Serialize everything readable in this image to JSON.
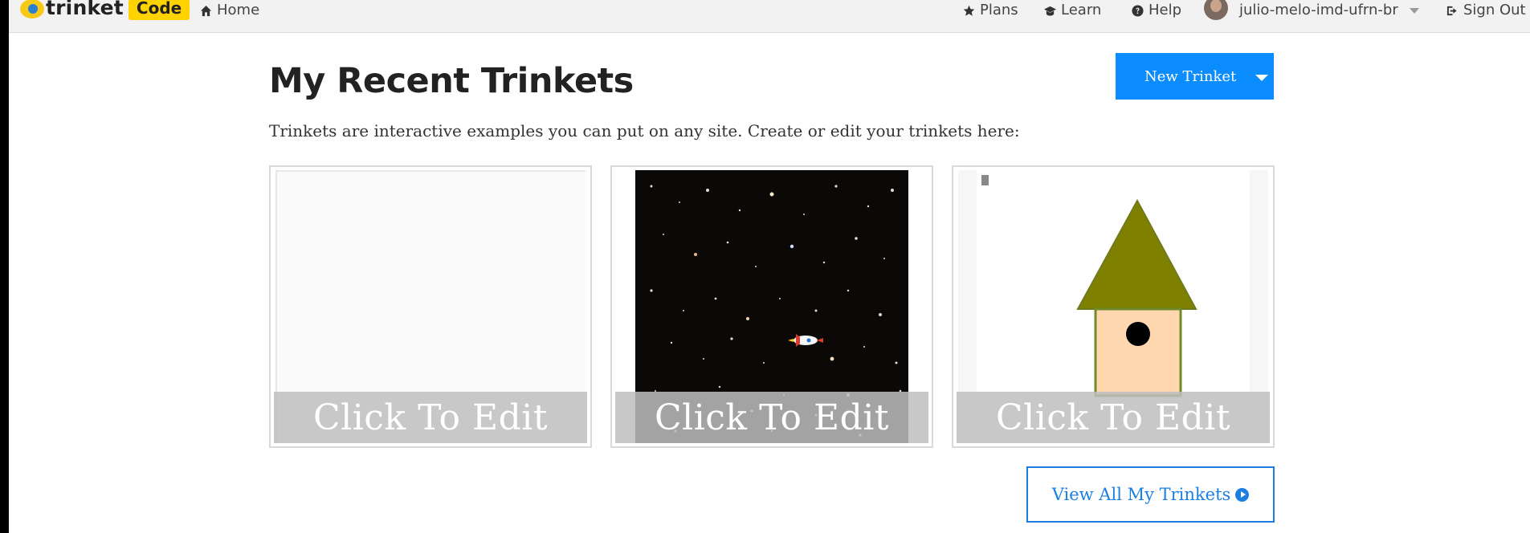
{
  "header": {
    "logo_text": "trinket",
    "logo_badge": "Code",
    "nav": {
      "home": "Home",
      "plans": "Plans",
      "learn": "Learn",
      "help": "Help",
      "username": "julio-melo-imd-ufrn-br",
      "signout": "Sign Out"
    },
    "icons": {
      "home": "home-icon",
      "plans": "star-icon",
      "learn": "graduation-cap-icon",
      "help": "question-circle-icon",
      "signout": "sign-out-icon"
    }
  },
  "main": {
    "title": "My Recent Trinkets",
    "subtitle": "Trinkets are interactive examples you can put on any site. Create or edit your trinkets here:",
    "new_button": "New Trinket",
    "cards": [
      {
        "overlay": "Click To Edit",
        "preview": "blank"
      },
      {
        "overlay": "Click To Edit",
        "preview": "space-rocket"
      },
      {
        "overlay": "Click To Edit",
        "preview": "birdhouse"
      }
    ],
    "view_all": "View All My Trinkets"
  },
  "colors": {
    "primary_blue": "#0b8cff",
    "badge_yellow": "#ffd200",
    "roof_olive": "#808000",
    "house_peach": "#ffd8b0"
  }
}
